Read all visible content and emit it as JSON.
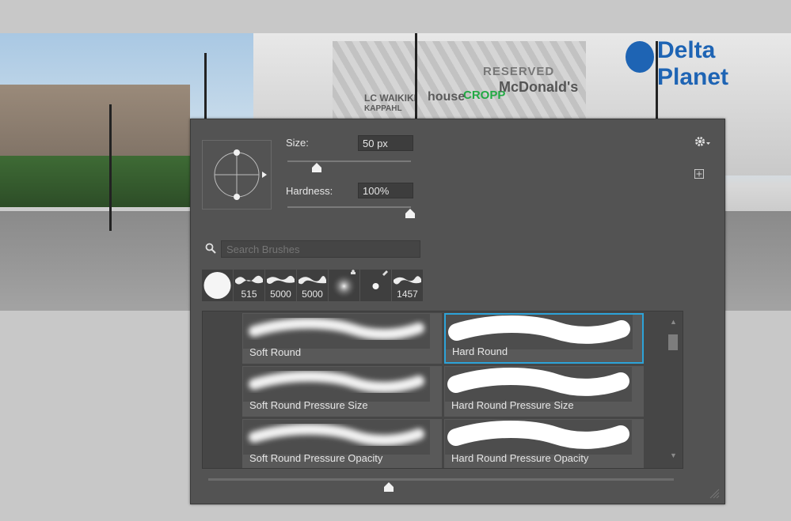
{
  "background": {
    "brand_text": "Delta Planet",
    "signs": [
      "LC WAIKIKI",
      "KAPPAHL",
      "RESERVED",
      "house",
      "CROPP",
      "McDonald's"
    ]
  },
  "brush_panel": {
    "size_label": "Size:",
    "size_value": "50 px",
    "size_fraction": 0.17,
    "hardness_label": "Hardness:",
    "hardness_value": "100%",
    "hardness_fraction": 1.0,
    "settings_icon": "gear-icon",
    "new_preset_icon": "plus-square-icon",
    "search_placeholder": "Search Brushes",
    "recent_brushes": [
      {
        "label": ""
      },
      {
        "label": "515"
      },
      {
        "label": "5000"
      },
      {
        "label": "5000"
      },
      {
        "label": ""
      },
      {
        "label": ""
      },
      {
        "label": "1457"
      }
    ],
    "brushes": [
      {
        "name": "Soft Round",
        "type": "soft"
      },
      {
        "name": "Hard Round",
        "type": "hard",
        "selected": true
      },
      {
        "name": "Soft Round Pressure Size",
        "type": "soft"
      },
      {
        "name": "Hard Round Pressure Size",
        "type": "hard"
      },
      {
        "name": "Soft Round Pressure Opacity",
        "type": "soft"
      },
      {
        "name": "Hard Round Pressure Opacity",
        "type": "hard"
      }
    ],
    "accent_color": "#2da3d8"
  }
}
